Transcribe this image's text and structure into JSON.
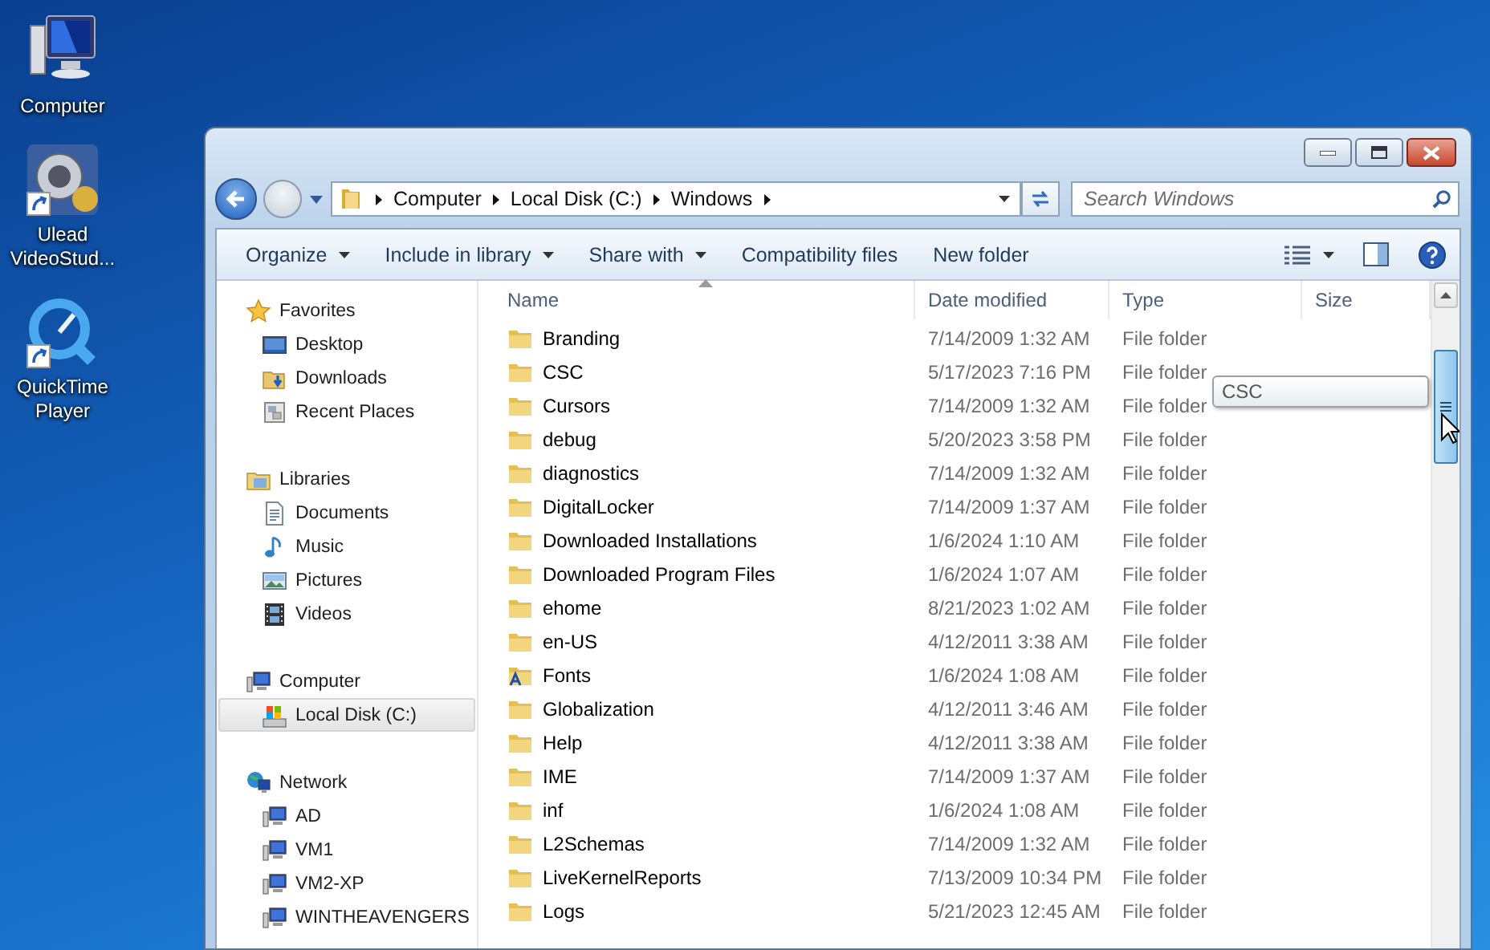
{
  "desktop_icons": [
    {
      "label": "Computer",
      "kind": "computer",
      "shortcut": false
    },
    {
      "label": "Ulead VideoStud...",
      "kind": "video-app",
      "shortcut": true
    },
    {
      "label": "QuickTime Player",
      "kind": "quicktime",
      "shortcut": true
    }
  ],
  "window": {
    "address": {
      "segments": [
        "Computer",
        "Local Disk (C:)",
        "Windows"
      ]
    },
    "search": {
      "placeholder": "Search Windows"
    },
    "toolbar": {
      "buttons": [
        {
          "label": "Organize",
          "dropdown": true
        },
        {
          "label": "Include in library",
          "dropdown": true
        },
        {
          "label": "Share with",
          "dropdown": true
        },
        {
          "label": "Compatibility files",
          "dropdown": false
        },
        {
          "label": "New folder",
          "dropdown": false
        }
      ]
    },
    "sidebar": {
      "groups": [
        {
          "label": "Favorites",
          "kind": "favorites",
          "selected": false,
          "items": [
            {
              "label": "Desktop",
              "kind": "desktop",
              "selected": false
            },
            {
              "label": "Downloads",
              "kind": "downloads",
              "selected": false
            },
            {
              "label": "Recent Places",
              "kind": "recent",
              "selected": false
            }
          ]
        },
        {
          "label": "Libraries",
          "kind": "libraries",
          "selected": false,
          "items": [
            {
              "label": "Documents",
              "kind": "documents",
              "selected": false
            },
            {
              "label": "Music",
              "kind": "music",
              "selected": false
            },
            {
              "label": "Pictures",
              "kind": "pictures",
              "selected": false
            },
            {
              "label": "Videos",
              "kind": "videos",
              "selected": false
            }
          ]
        },
        {
          "label": "Computer",
          "kind": "computer",
          "selected": false,
          "items": [
            {
              "label": "Local Disk (C:)",
              "kind": "drive",
              "selected": true
            }
          ]
        },
        {
          "label": "Network",
          "kind": "network",
          "selected": false,
          "items": [
            {
              "label": "AD",
              "kind": "pc",
              "selected": false
            },
            {
              "label": "VM1",
              "kind": "pc",
              "selected": false
            },
            {
              "label": "VM2-XP",
              "kind": "pc",
              "selected": false
            },
            {
              "label": "WINTHEAVENGERS",
              "kind": "pc",
              "selected": false
            }
          ]
        }
      ]
    },
    "file_list": {
      "columns": [
        {
          "label": "Name",
          "sorted": true
        },
        {
          "label": "Date modified",
          "sorted": false
        },
        {
          "label": "Type",
          "sorted": false
        },
        {
          "label": "Size",
          "sorted": false
        }
      ],
      "rows": [
        {
          "name": "Branding",
          "date": "7/14/2009 1:32 AM",
          "type": "File folder",
          "kind": "folder"
        },
        {
          "name": "CSC",
          "date": "5/17/2023 7:16 PM",
          "type": "File folder",
          "kind": "folder"
        },
        {
          "name": "Cursors",
          "date": "7/14/2009 1:32 AM",
          "type": "File folder",
          "kind": "folder"
        },
        {
          "name": "debug",
          "date": "5/20/2023 3:58 PM",
          "type": "File folder",
          "kind": "folder"
        },
        {
          "name": "diagnostics",
          "date": "7/14/2009 1:32 AM",
          "type": "File folder",
          "kind": "folder"
        },
        {
          "name": "DigitalLocker",
          "date": "7/14/2009 1:37 AM",
          "type": "File folder",
          "kind": "folder"
        },
        {
          "name": "Downloaded Installations",
          "date": "1/6/2024 1:10 AM",
          "type": "File folder",
          "kind": "folder"
        },
        {
          "name": "Downloaded Program Files",
          "date": "1/6/2024 1:07 AM",
          "type": "File folder",
          "kind": "folder"
        },
        {
          "name": "ehome",
          "date": "8/21/2023 1:02 AM",
          "type": "File folder",
          "kind": "folder"
        },
        {
          "name": "en-US",
          "date": "4/12/2011 3:38 AM",
          "type": "File folder",
          "kind": "folder"
        },
        {
          "name": "Fonts",
          "date": "1/6/2024 1:08 AM",
          "type": "File folder",
          "kind": "fonts"
        },
        {
          "name": "Globalization",
          "date": "4/12/2011 3:46 AM",
          "type": "File folder",
          "kind": "folder"
        },
        {
          "name": "Help",
          "date": "4/12/2011 3:38 AM",
          "type": "File folder",
          "kind": "folder"
        },
        {
          "name": "IME",
          "date": "7/14/2009 1:37 AM",
          "type": "File folder",
          "kind": "folder"
        },
        {
          "name": "inf",
          "date": "1/6/2024 1:08 AM",
          "type": "File folder",
          "kind": "folder"
        },
        {
          "name": "L2Schemas",
          "date": "7/14/2009 1:32 AM",
          "type": "File folder",
          "kind": "folder"
        },
        {
          "name": "LiveKernelReports",
          "date": "7/13/2009 10:34 PM",
          "type": "File folder",
          "kind": "folder"
        },
        {
          "name": "Logs",
          "date": "5/21/2023 12:45 AM",
          "type": "File folder",
          "kind": "folder"
        }
      ]
    },
    "tooltip": "CSC"
  }
}
